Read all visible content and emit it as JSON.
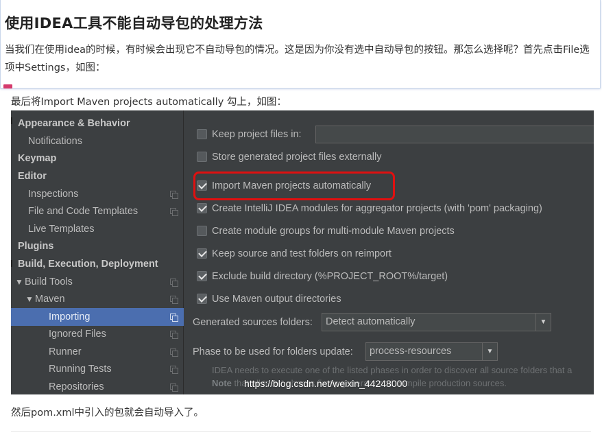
{
  "article": {
    "title": "使用IDEA工具不能自动导包的处理方法",
    "paragraph": "当我们在使用idea的时候，有时候会出现它不自动导包的情况。这是因为你没有选中自动导包的按钮。那怎么选择呢？首先点击File选项中Settings，如图：",
    "caption_top": "最后将Import Maven projects automatically 勾上，如图：",
    "caption_bottom": "然后pom.xml中引入的包就会自动导入了。"
  },
  "ide": {
    "sidebar": {
      "items": [
        {
          "label": "Appearance & Behavior",
          "bold": true
        },
        {
          "label": "Notifications"
        },
        {
          "label": "Keymap",
          "bold": true
        },
        {
          "label": "Editor",
          "bold": true
        },
        {
          "label": "Inspections"
        },
        {
          "label": "File and Code Templates"
        },
        {
          "label": "Live Templates"
        },
        {
          "label": "Plugins",
          "bold": true
        },
        {
          "label": "Build, Execution, Deployment",
          "bold": true
        },
        {
          "label": "Build Tools",
          "expanded": true
        },
        {
          "label": "Maven",
          "expanded": true
        },
        {
          "label": "Importing",
          "selected": true
        },
        {
          "label": "Ignored Files"
        },
        {
          "label": "Runner"
        },
        {
          "label": "Running Tests"
        },
        {
          "label": "Repositories"
        }
      ]
    },
    "options": [
      {
        "label": "Keep project files in:",
        "checked": false
      },
      {
        "label": "Store generated project files externally",
        "checked": false
      },
      {
        "label": "Import Maven projects automatically",
        "checked": true
      },
      {
        "label": "Create IntelliJ IDEA modules for aggregator projects (with 'pom' packaging)",
        "checked": true
      },
      {
        "label": "Create module groups for multi-module Maven projects",
        "checked": false
      },
      {
        "label": "Keep source and test folders on reimport",
        "checked": true
      },
      {
        "label": "Exclude build directory (%PROJECT_ROOT%/target)",
        "checked": true
      },
      {
        "label": "Use Maven output directories",
        "checked": true
      }
    ],
    "generated_sources": {
      "label": "Generated sources folders:",
      "value": "Detect automatically"
    },
    "phase": {
      "label": "Phase to be used for folders update:",
      "value": "process-resources"
    },
    "note_line1": "IDEA needs to execute one of the listed phases in order to discover all source folders that a",
    "note_bold": "Note",
    "note_line2": " that all test-* phases firstly generate and compile production sources.",
    "watermark": "https://blog.csdn.net/weixin_44248000",
    "colors": {
      "selection": "#4b6eaf",
      "highlight_ring": "#e01010",
      "panel": "#3c3f41"
    }
  }
}
